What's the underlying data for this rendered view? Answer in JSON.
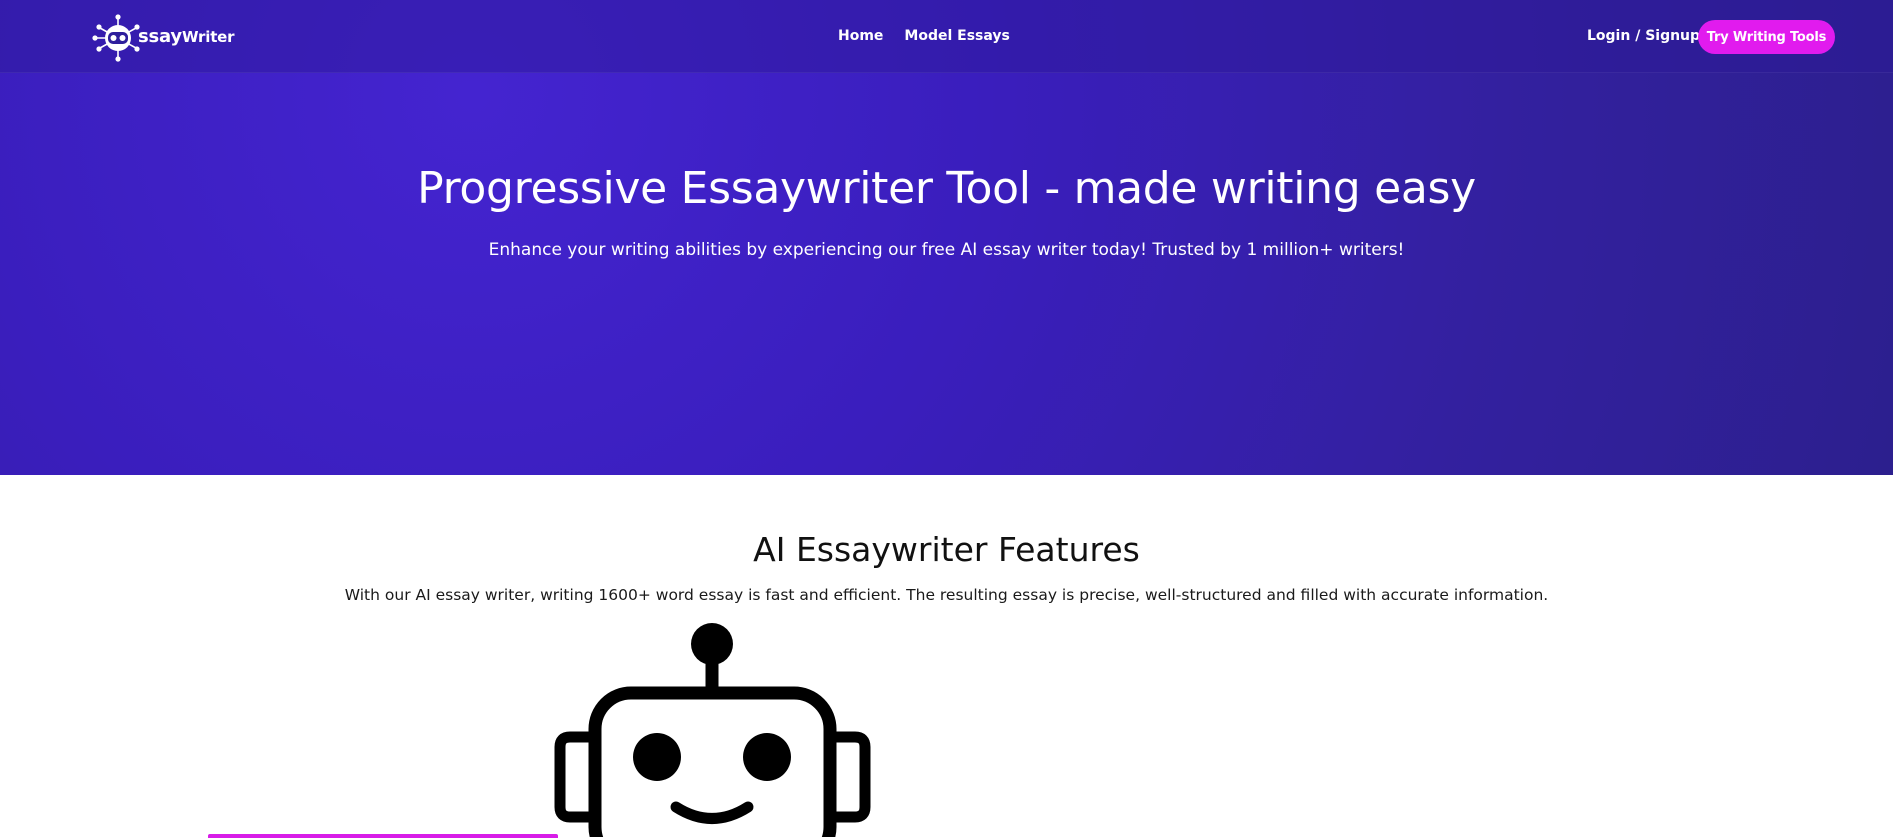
{
  "nav": {
    "logo_text_main": "ssay",
    "logo_text_suffix": "Writer",
    "links": [
      "Home",
      "Model Essays"
    ],
    "login_label": "Login / Signup",
    "cta_label": "Try Writing Tools"
  },
  "hero": {
    "title": "Progressive Essaywriter Tool - made writing easy",
    "subtitle": "Enhance your writing abilities by experiencing our free AI essay writer today! Trusted by 1 million+ writers!"
  },
  "features": {
    "title": "AI Essaywriter Features",
    "description": "With our AI essay writer, writing 1600+ word essay is fast and efficient. The resulting essay is precise, well-structured and filled with accurate information."
  },
  "icons": {
    "logo": "robot-logo-icon",
    "illustration": "robot-face-icon"
  },
  "colors": {
    "hero_background": "#3a1ebd",
    "cta_background": "#e11bee",
    "accent_bar": "#d81ce8"
  }
}
